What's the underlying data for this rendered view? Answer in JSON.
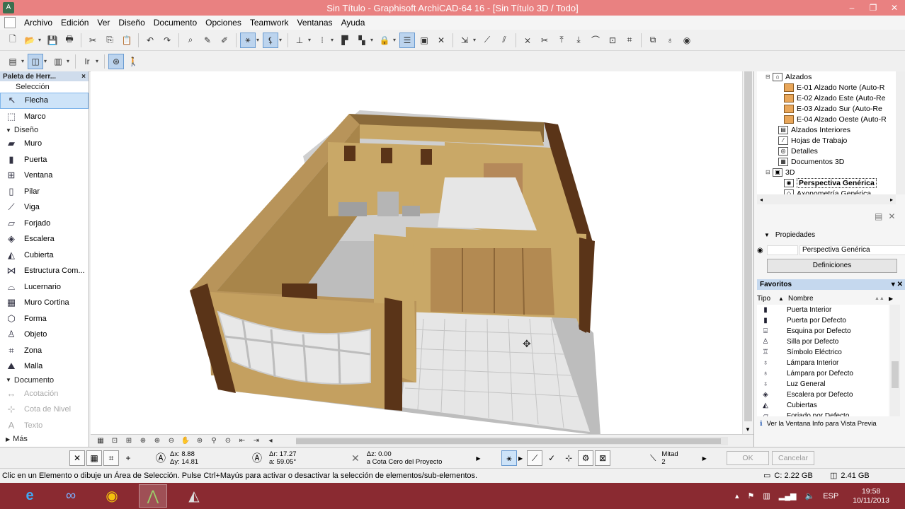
{
  "window": {
    "title": "Sin Título - Graphisoft ArchiCAD-64 16 - [Sin Título 3D / Todo]",
    "controls": [
      "–",
      "❐",
      "✕"
    ]
  },
  "menu": {
    "items": [
      "Archivo",
      "Edición",
      "Ver",
      "Diseño",
      "Documento",
      "Opciones",
      "Teamwork",
      "Ventanas",
      "Ayuda"
    ]
  },
  "toolbox": {
    "title": "Paleta de Herr...",
    "close": "×",
    "selection_label": "Selección",
    "selection_tools": [
      {
        "label": "Flecha",
        "icon": "arrow-icon"
      },
      {
        "label": "Marco",
        "icon": "marquee-icon"
      }
    ],
    "design_label": "Diseño",
    "design_tools": [
      {
        "label": "Muro",
        "icon": "wall-icon"
      },
      {
        "label": "Puerta",
        "icon": "door-icon"
      },
      {
        "label": "Ventana",
        "icon": "window-icon"
      },
      {
        "label": "Pilar",
        "icon": "column-icon"
      },
      {
        "label": "Viga",
        "icon": "beam-icon"
      },
      {
        "label": "Forjado",
        "icon": "slab-icon"
      },
      {
        "label": "Escalera",
        "icon": "stair-icon"
      },
      {
        "label": "Cubierta",
        "icon": "roof-icon"
      },
      {
        "label": "Estructura Com...",
        "icon": "truss-icon"
      },
      {
        "label": "Lucernario",
        "icon": "skylight-icon"
      },
      {
        "label": "Muro Cortina",
        "icon": "curtain-wall-icon"
      },
      {
        "label": "Forma",
        "icon": "morph-icon"
      },
      {
        "label": "Objeto",
        "icon": "object-icon"
      },
      {
        "label": "Zona",
        "icon": "zone-icon"
      },
      {
        "label": "Malla",
        "icon": "mesh-icon"
      }
    ],
    "document_label": "Documento",
    "document_tools": [
      {
        "label": "Acotación",
        "icon": "dimension-icon"
      },
      {
        "label": "Cota de Nivel",
        "icon": "level-dimension-icon"
      },
      {
        "label": "Texto",
        "icon": "text-icon"
      }
    ],
    "more_label": "Más"
  },
  "navigator": {
    "items": [
      {
        "label": "Alzados",
        "indent": 1,
        "expand": "⊟",
        "icon": "⌂",
        "house": false
      },
      {
        "label": "E-01 Alzado Norte (Auto-R",
        "indent": 3,
        "expand": "",
        "icon": "",
        "house": true
      },
      {
        "label": "E-02 Alzado Este (Auto-Re",
        "indent": 3,
        "expand": "",
        "icon": "",
        "house": true
      },
      {
        "label": "E-03 Alzado Sur (Auto-Re",
        "indent": 3,
        "expand": "",
        "icon": "",
        "house": true
      },
      {
        "label": "E-04 Alzado Oeste (Auto-R",
        "indent": 3,
        "expand": "",
        "icon": "",
        "house": true
      },
      {
        "label": "Alzados Interiores",
        "indent": 2,
        "expand": "",
        "icon": "▤",
        "house": false
      },
      {
        "label": "Hojas de Trabajo",
        "indent": 2,
        "expand": "",
        "icon": "⁄",
        "house": false
      },
      {
        "label": "Detalles",
        "indent": 2,
        "expand": "",
        "icon": "◎",
        "house": false
      },
      {
        "label": "Documentos 3D",
        "indent": 2,
        "expand": "",
        "icon": "▦",
        "house": false
      },
      {
        "label": "3D",
        "indent": 1,
        "expand": "⊟",
        "icon": "▣",
        "house": false
      },
      {
        "label": "Perspectiva Genérica",
        "indent": 3,
        "expand": "",
        "icon": "◉",
        "house": false,
        "selected": true
      },
      {
        "label": "Axonometría Genérica",
        "indent": 3,
        "expand": "",
        "icon": "◇",
        "house": false
      }
    ]
  },
  "properties": {
    "header": "Propiedades",
    "view_name": "Perspectiva Genérica",
    "definitions_button": "Definiciones"
  },
  "favorites": {
    "header": "Favoritos",
    "col_type": "Tipo",
    "col_name": "Nombre",
    "items": [
      {
        "label": "Puerta Interior",
        "icon": "▮"
      },
      {
        "label": "Puerta por Defecto",
        "icon": "▮"
      },
      {
        "label": "Esquina por Defecto",
        "icon": "⌸"
      },
      {
        "label": "Silla por Defecto",
        "icon": "♙"
      },
      {
        "label": "Símbolo Eléctrico",
        "icon": "♖"
      },
      {
        "label": "Lámpara Interior",
        "icon": "♁"
      },
      {
        "label": "Lámpara por Defecto",
        "icon": "♁"
      },
      {
        "label": "Luz General",
        "icon": "♁"
      },
      {
        "label": "Escalera por Defecto",
        "icon": "◈"
      },
      {
        "label": "Cubiertas",
        "icon": "◭"
      },
      {
        "label": "Forjado por Defecto",
        "icon": "▱"
      }
    ],
    "info_link": "Ver la Ventana Info para Vista Previa"
  },
  "infobox": {
    "dx": "Δx: 8.88",
    "dy": "Δy: 14.81",
    "dr": "Δr: 17.27",
    "angle": "a: 59.05°",
    "dz": "Δz: 0.00",
    "reference": "a Cota Cero del Proyecto",
    "mitad_label": "Mitad",
    "mitad_value": "2",
    "ok": "OK",
    "cancel": "Cancelar"
  },
  "status": {
    "message": "Clic en un Elemento o dibuje un Área de Selección. Pulse Ctrl+Mayús para activar o desactivar la selección de elementos/sub-elementos.",
    "disk": "C: 2.22 GB",
    "memory": "2.41 GB"
  },
  "taskbar": {
    "language": "ESP",
    "time": "19:58",
    "date": "10/11/2013"
  },
  "colors": {
    "titlebar": "#e98181",
    "taskbar": "#8a2a31",
    "wall_tan": "#c9a867",
    "wall_dark": "#5a3418",
    "floor_tile": "#e4e4e4"
  }
}
